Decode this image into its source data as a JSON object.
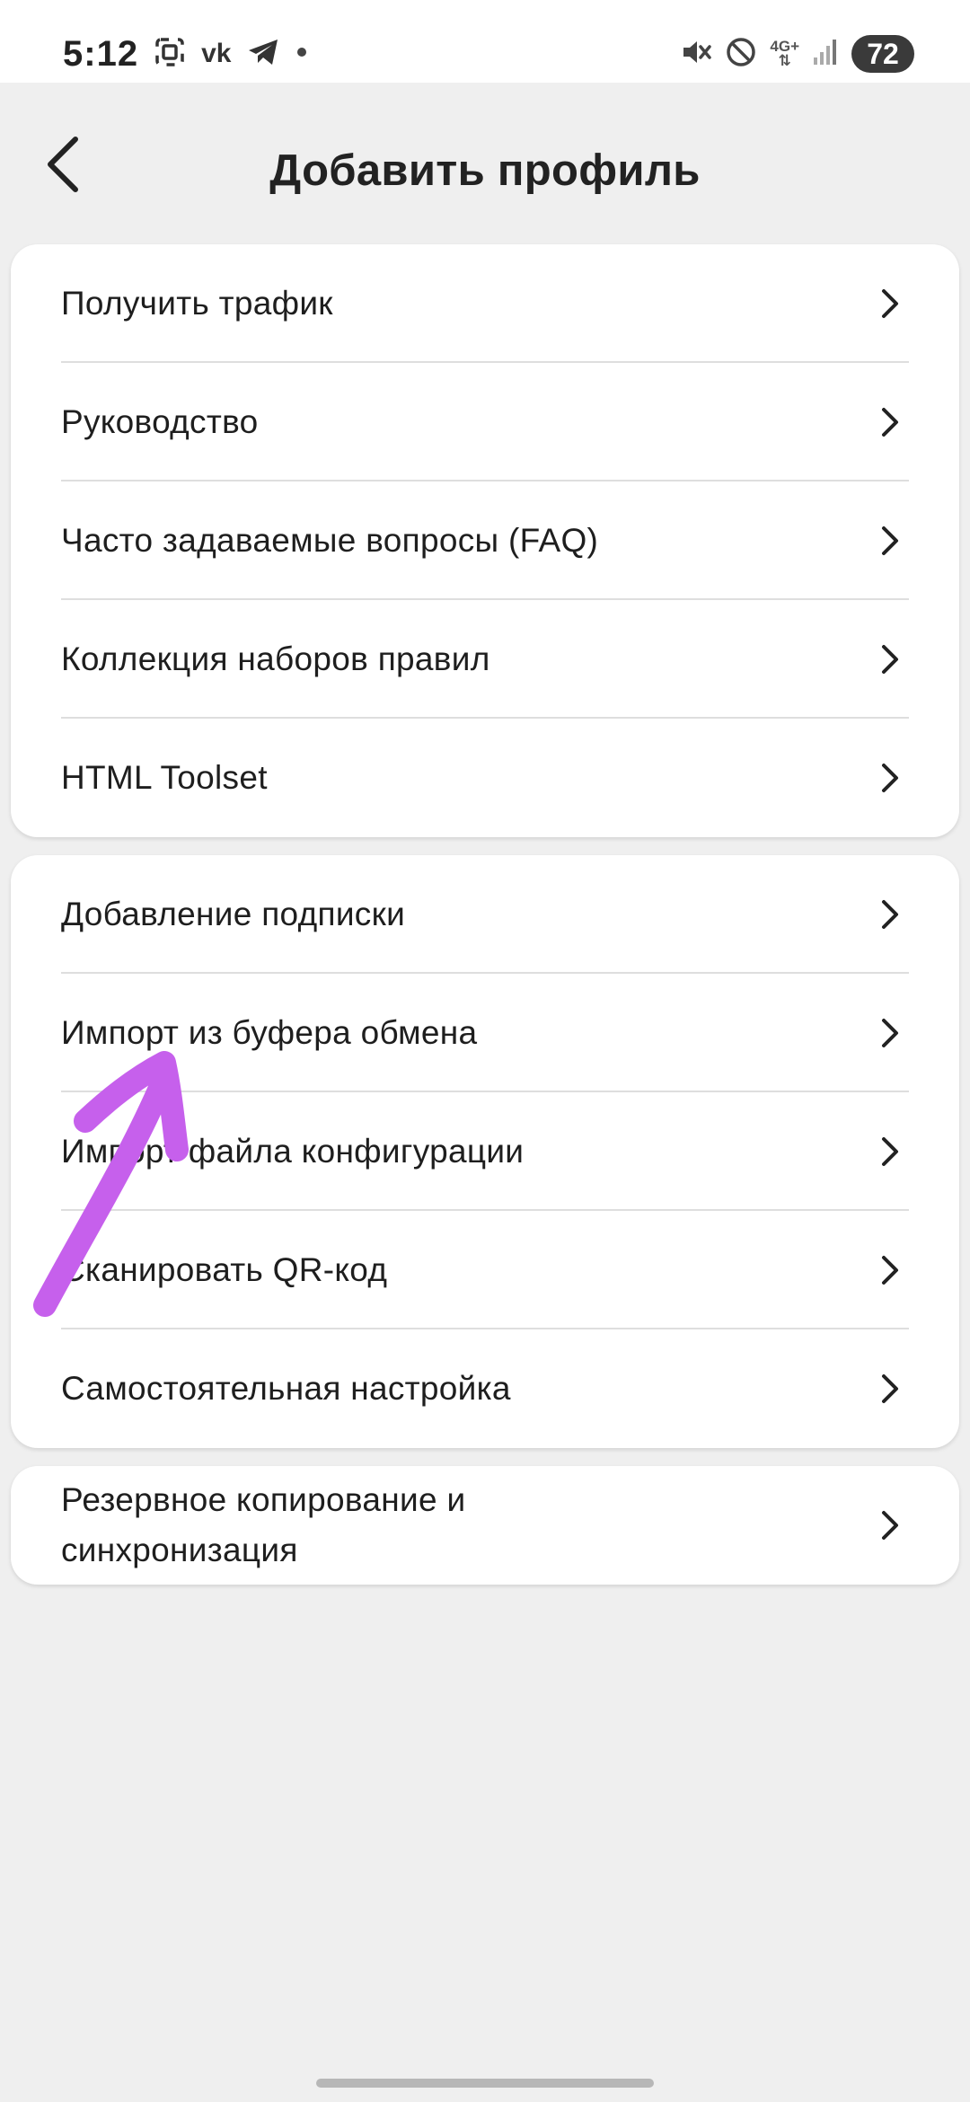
{
  "status_bar": {
    "time": "5:12",
    "vk_label": "vk",
    "network": "4G+",
    "battery": "72"
  },
  "header": {
    "title": "Добавить профиль"
  },
  "groups": [
    {
      "items": [
        {
          "label": "Получить трафик"
        },
        {
          "label": "Руководство"
        },
        {
          "label": "Часто задаваемые вопросы (FAQ)"
        },
        {
          "label": "Коллекция наборов правил"
        },
        {
          "label": "HTML Toolset"
        }
      ]
    },
    {
      "items": [
        {
          "label": "Добавление подписки"
        },
        {
          "label": "Импорт из буфера обмена"
        },
        {
          "label": "Импорт файла конфигурации"
        },
        {
          "label": "Сканировать QR-код"
        },
        {
          "label": "Самостоятельная настройка"
        }
      ]
    },
    {
      "items": [
        {
          "label": "Резервное копирование и синхронизация"
        }
      ]
    }
  ],
  "annotation": {
    "color": "#c660ec",
    "icon": "arrow-icon"
  }
}
